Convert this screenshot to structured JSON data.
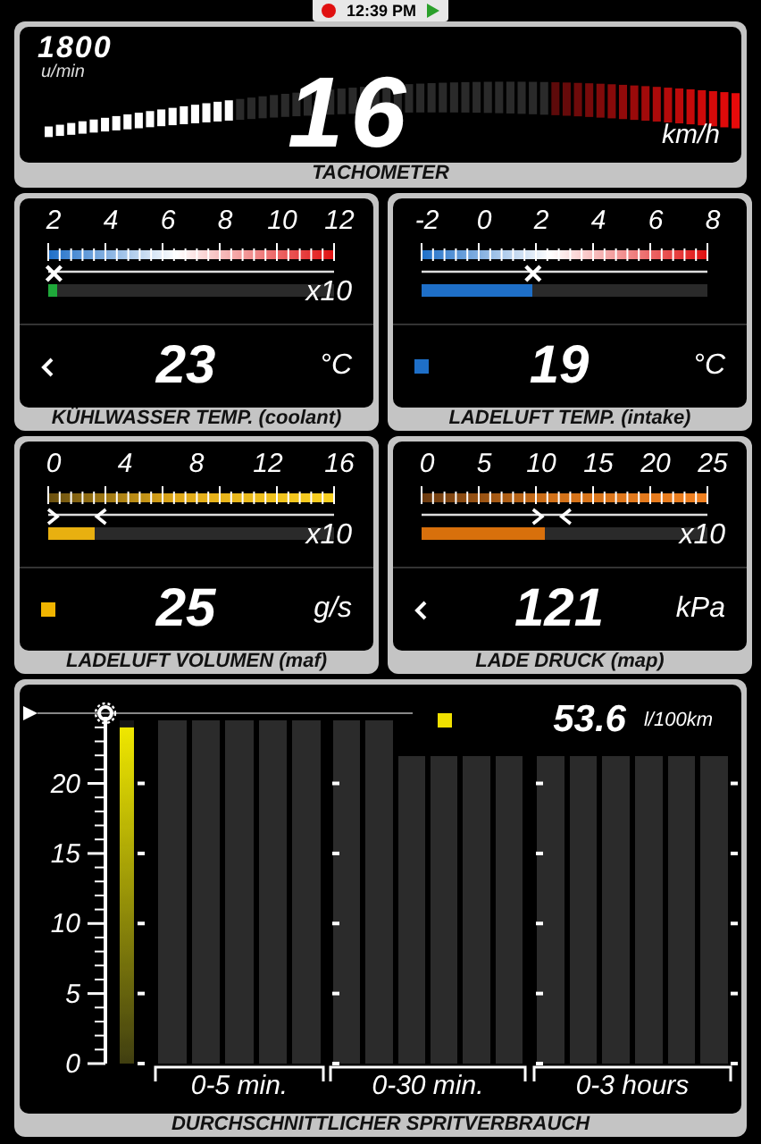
{
  "status_bar": {
    "recording": true,
    "time": "12:39 PM",
    "playing": true
  },
  "tachometer": {
    "rpm": "1800",
    "rpm_unit": "u/min",
    "level": 0.27,
    "speed": "16",
    "speed_unit": "km/h",
    "title": "TACHOMETER"
  },
  "gauges": [
    {
      "kind": "temperature",
      "scale": [
        "2",
        "4",
        "6",
        "8",
        "10",
        "12"
      ],
      "multiplier": "x10",
      "markers": [
        {
          "kind": "cross",
          "level": 0.02
        }
      ],
      "level": 0.03,
      "color": "#1fa83a",
      "indicator": {
        "kind": "chevron"
      },
      "value": "23",
      "unit": "°C",
      "title": "KÜHLWASSER TEMP. (coolant)"
    },
    {
      "kind": "temperature",
      "scale": [
        "-2",
        "0",
        "2",
        "4",
        "6",
        "8"
      ],
      "markers": [
        {
          "kind": "cross",
          "level": 0.39
        }
      ],
      "level": 0.39,
      "color": "#1e6fc8",
      "indicator": {
        "kind": "square",
        "color": "#1e6fc8"
      },
      "value": "19",
      "unit": "°C",
      "title": "LADELUFT TEMP. (intake)"
    },
    {
      "kind": "flow",
      "scale": [
        "0",
        "4",
        "8",
        "12",
        "16"
      ],
      "multiplier": "x10",
      "markers": [
        {
          "kind": "right-arrow",
          "level": 0.0
        },
        {
          "kind": "left-arrow",
          "level": 0.17
        }
      ],
      "level": 0.16,
      "color": "#e8b010",
      "indicator": {
        "kind": "square",
        "color": "#f0b400"
      },
      "value": "25",
      "unit": "g/s",
      "title": "LADELUFT VOLUMEN (maf)"
    },
    {
      "kind": "pressure",
      "scale": [
        "0",
        "5",
        "10",
        "15",
        "20",
        "25"
      ],
      "multiplier": "x10",
      "markers": [
        {
          "kind": "right-arrow",
          "level": 0.39
        },
        {
          "kind": "left-arrow",
          "level": 0.49
        }
      ],
      "level": 0.43,
      "color": "#d8700c",
      "indicator": {
        "kind": "chevron"
      },
      "value": "121",
      "unit": "kPa",
      "title": "LADE DRUCK (map)"
    }
  ],
  "consumption": {
    "title": "DURCHSCHNITTLICHER SPRITVERBRAUCH",
    "readout": {
      "value": "53.6",
      "unit": "l/100km",
      "color": "#f0e000"
    },
    "current_bar": {
      "level": 0.98
    },
    "axis_labels": [
      "20",
      "15",
      "10",
      "5",
      "0"
    ],
    "period_labels": [
      "0-5 min.",
      "0-30 min.",
      "0-3 hours"
    ]
  }
}
